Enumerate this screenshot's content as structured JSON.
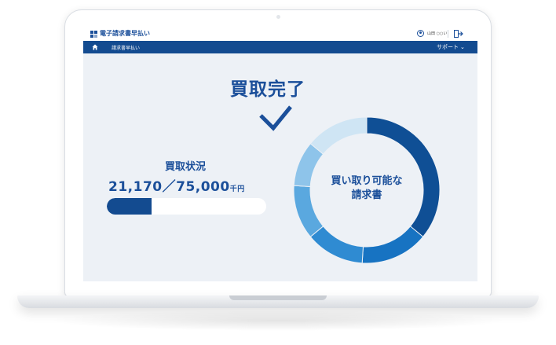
{
  "app": {
    "title": "電子請求書早払い",
    "user_name": "山田 ○○い"
  },
  "nav": {
    "current": "請求書早払い",
    "support": "サポート"
  },
  "main": {
    "heading": "買取完了",
    "status_label": "買取状況",
    "amount_current": "21,170",
    "amount_separator": "／",
    "amount_total": "75,000",
    "amount_unit": "千円",
    "progress_fraction": 0.2823,
    "donut_label_line1": "買い取り可能な",
    "donut_label_line2": "請求書"
  },
  "colors": {
    "brand_dark": "#134b90",
    "brand_text": "#1b4f9a",
    "donut_segments": [
      "#0f4f95",
      "#1773c2",
      "#2f8bd2",
      "#5aa8df",
      "#8ec4ea",
      "#cfe5f4"
    ]
  },
  "donut_segments": [
    {
      "fraction": 0.36
    },
    {
      "fraction": 0.15
    },
    {
      "fraction": 0.13
    },
    {
      "fraction": 0.12
    },
    {
      "fraction": 0.1
    },
    {
      "fraction": 0.14
    }
  ],
  "icons": [
    "logo-icon",
    "user-icon",
    "logout-icon",
    "home-icon",
    "chevron-down-icon",
    "checkmark-icon"
  ]
}
